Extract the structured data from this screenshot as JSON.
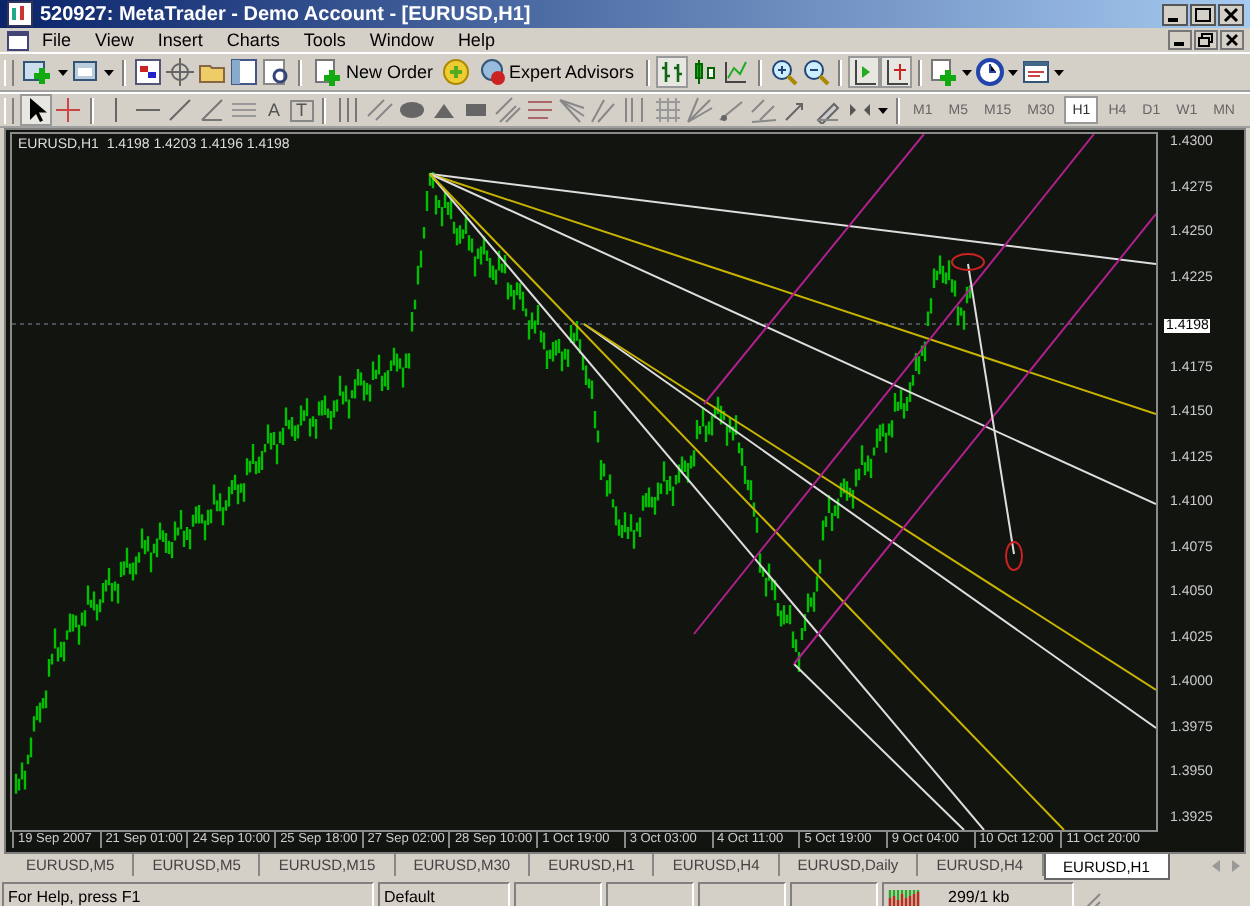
{
  "window": {
    "title": "520927: MetaTrader - Demo Account - [EURUSD,H1]"
  },
  "menu": [
    "File",
    "View",
    "Insert",
    "Charts",
    "Tools",
    "Window",
    "Help"
  ],
  "toolbar": {
    "buttons": [
      {
        "label": "New Order"
      },
      {
        "label": "Expert Advisors"
      }
    ]
  },
  "text_tools": [
    "A",
    "T"
  ],
  "timeframes": [
    {
      "label": "M1",
      "selected": false
    },
    {
      "label": "M5",
      "selected": false
    },
    {
      "label": "M15",
      "selected": false
    },
    {
      "label": "M30",
      "selected": false
    },
    {
      "label": "H1",
      "selected": true
    },
    {
      "label": "H4",
      "selected": false
    },
    {
      "label": "D1",
      "selected": false
    },
    {
      "label": "W1",
      "selected": false
    },
    {
      "label": "MN",
      "selected": false
    }
  ],
  "chart": {
    "info": "EURUSD,H1  1.4198 1.4203 1.4196 1.4198",
    "current_price": "1.4198",
    "price_labels": [
      "1.4300",
      "1.4275",
      "1.4250",
      "1.4225",
      "1.4175",
      "1.4150",
      "1.4125",
      "1.4100",
      "1.4075",
      "1.4050",
      "1.4025",
      "1.4000",
      "1.3975",
      "1.3950",
      "1.3925"
    ],
    "time_labels": [
      "19 Sep 2007",
      "21 Sep 01:00",
      "24 Sep 10:00",
      "25 Sep 18:00",
      "27 Sep 02:00",
      "28 Sep 10:00",
      "1 Oct 19:00",
      "3 Oct 03:00",
      "4 Oct 11:00",
      "5 Oct 19:00",
      "9 Oct 04:00",
      "10 Oct 12:00",
      "11 Oct 20:00"
    ]
  },
  "chart_tabs": [
    {
      "label": "EURUSD,M5",
      "selected": false
    },
    {
      "label": "EURUSD,M5",
      "selected": false
    },
    {
      "label": "EURUSD,M15",
      "selected": false
    },
    {
      "label": "EURUSD,M30",
      "selected": false
    },
    {
      "label": "EURUSD,H1",
      "selected": false
    },
    {
      "label": "EURUSD,H4",
      "selected": false
    },
    {
      "label": "EURUSD,Daily",
      "selected": false
    },
    {
      "label": "EURUSD,H4",
      "selected": false
    },
    {
      "label": "EURUSD,H1",
      "selected": true
    }
  ],
  "status_bar": {
    "help": "For Help, press F1",
    "profile": "Default",
    "traffic": "299/1 kb"
  }
}
